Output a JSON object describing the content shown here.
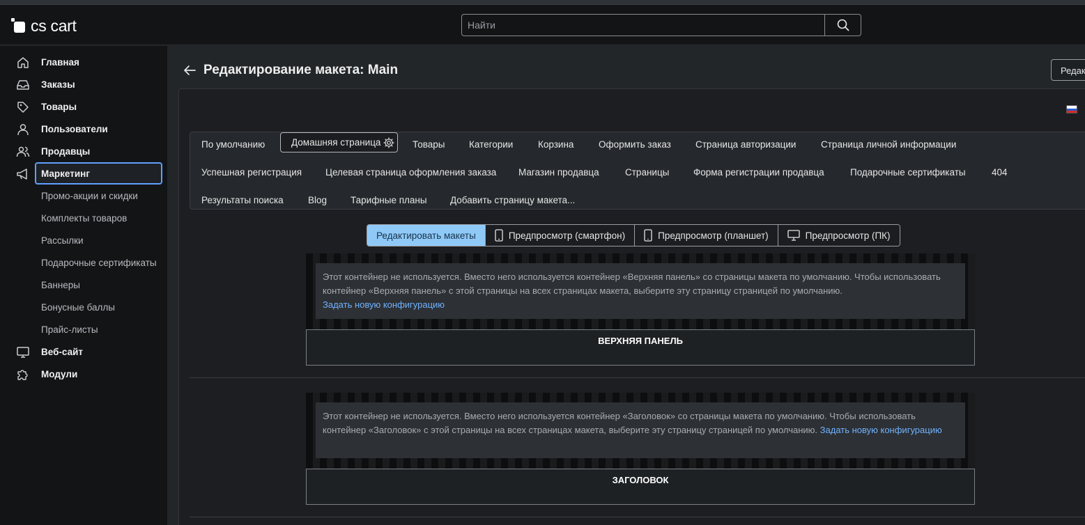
{
  "app": {
    "logo": "cs cart"
  },
  "search": {
    "placeholder": "Найти"
  },
  "sidebar": {
    "items": [
      {
        "label": "Главная",
        "icon": "home-icon"
      },
      {
        "label": "Заказы",
        "icon": "inbox-icon"
      },
      {
        "label": "Товары",
        "icon": "tag-icon"
      },
      {
        "label": "Пользователи",
        "icon": "user-icon"
      },
      {
        "label": "Продавцы",
        "icon": "users-icon"
      },
      {
        "label": "Маркетинг",
        "icon": "megaphone-icon",
        "active": true
      },
      {
        "label": "Веб-сайт",
        "icon": "monitor-icon"
      },
      {
        "label": "Модули",
        "icon": "puzzle-icon"
      }
    ],
    "marketing_subitems": [
      "Промо-акции и скидки",
      "Комплекты товаров",
      "Рассылки",
      "Подарочные сертификаты",
      "Баннеры",
      "Бонусные баллы",
      "Прайс-листы"
    ]
  },
  "page": {
    "title": "Редактирование макета: Main",
    "edit_button": "Редак"
  },
  "layout_tabs": [
    "По умолчанию",
    "Домашняя страница",
    "Товары",
    "Категории",
    "Корзина",
    "Оформить заказ",
    "Страница авторизации",
    "Страница личной информации",
    "Успешная регистрация",
    "Целевая страница оформления заказа",
    "Магазин продавца",
    "Страницы",
    "Форма регистрации продавца",
    "Подарочные сертификаты",
    "404",
    "Результаты поиска",
    "Blog",
    "Тарифные планы",
    "Добавить страницу макета..."
  ],
  "active_tab": "Домашняя страница",
  "view_modes": [
    {
      "label": "Редактировать макеты",
      "active": true
    },
    {
      "label": "Предпросмотр (смартфон)",
      "icon": "smartphone-icon"
    },
    {
      "label": "Предпросмотр (планшет)",
      "icon": "tablet-icon"
    },
    {
      "label": "Предпросмотр (ПК)",
      "icon": "monitor-icon"
    }
  ],
  "containers": [
    {
      "title": "ВЕРХНЯЯ ПАНЕЛЬ",
      "notice_text": "Этот контейнер не используется. Вместо него используется контейнер «Верхняя панель» со страницы макета по умолчанию. Чтобы использовать контейнер «Верхняя панель» с этой страницы на всех страницах макета, выберите эту страницу страницей по умолчанию.",
      "notice_link": "Задать новую конфигурацию"
    },
    {
      "title": "ЗАГОЛОВОК",
      "notice_text": "Этот контейнер не используется. Вместо него используется контейнер «Заголовок» со страницы макета по умолчанию. Чтобы использовать контейнер «Заголовок» с этой страницы на всех страницах макета, выберите эту страницу страницей по умолчанию.",
      "notice_link": "Задать новую конфигурацию"
    }
  ],
  "colors": {
    "accent": "#5ea0ff",
    "active_mode_bg": "#8fc9f7",
    "link": "#6fb2ff",
    "header_bg": "#131416"
  }
}
